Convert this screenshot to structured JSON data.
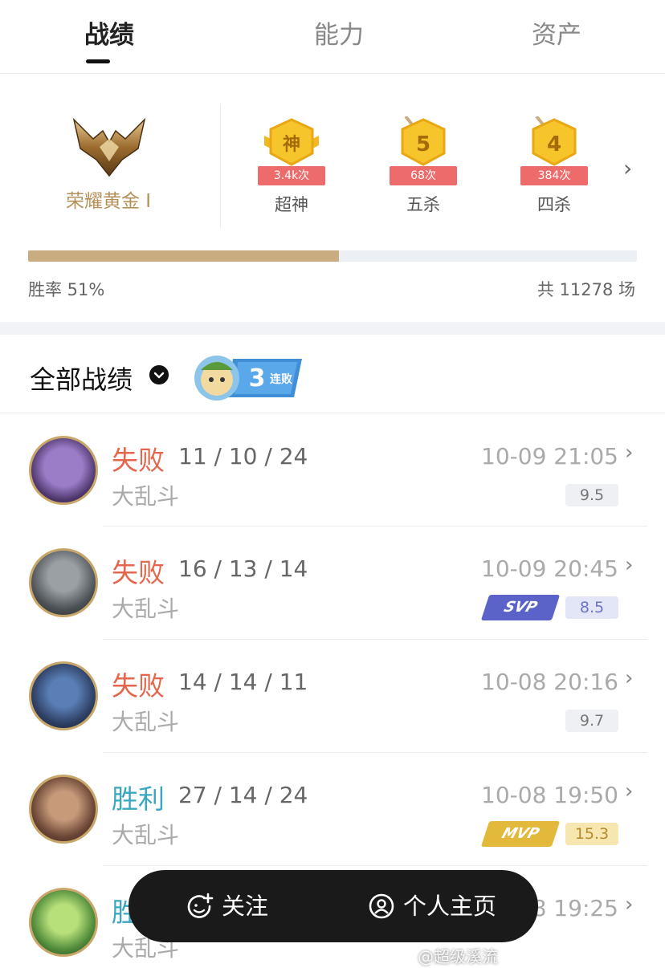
{
  "tabs": {
    "record": "战绩",
    "ability": "能力",
    "assets": "资产"
  },
  "rank": {
    "name": "荣耀黄金 I"
  },
  "achievements": [
    {
      "glyph": "神",
      "count": "3.4k次",
      "label": "超神"
    },
    {
      "glyph": "5",
      "count": "68次",
      "label": "五杀"
    },
    {
      "glyph": "4",
      "count": "384次",
      "label": "四杀"
    }
  ],
  "stats": {
    "winrate_text": "胜率 51%",
    "winrate_fraction": 0.51,
    "total_text": "共 11278 场"
  },
  "section": {
    "title": "全部战绩",
    "streak_num": "3",
    "streak_text": "连败"
  },
  "matches": [
    {
      "result": "失败",
      "kda": "11 / 10 / 24",
      "mode": "大乱斗",
      "time": "10-09 21:05",
      "score": "9.5"
    },
    {
      "result": "失败",
      "kda": "16 / 13 / 14",
      "mode": "大乱斗",
      "time": "10-09 20:45",
      "score": "8.5",
      "tag": "SVP"
    },
    {
      "result": "失败",
      "kda": "14 / 14 / 11",
      "mode": "大乱斗",
      "time": "10-08 20:16",
      "score": "9.7"
    },
    {
      "result": "胜利",
      "kda": "27 / 14 / 24",
      "mode": "大乱斗",
      "time": "10-08 19:50",
      "score": "15.3",
      "tag": "MVP"
    },
    {
      "result": "胜",
      "mode": "大乱斗",
      "time": "8 19:25"
    }
  ],
  "actions": {
    "follow": "关注",
    "profile": "个人主页"
  },
  "watermark": "@超级溪流",
  "colors": {
    "lose": "#e4674d",
    "win": "#3aa7c1",
    "gold": "#c9ad80",
    "svp": "#5b63c8",
    "mvp": "#e3b93b"
  }
}
